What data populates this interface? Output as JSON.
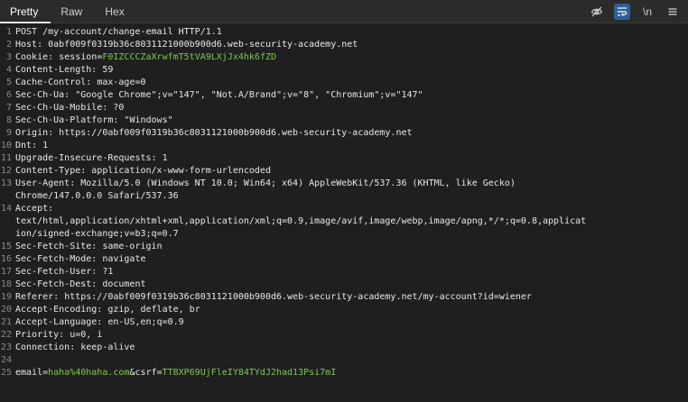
{
  "tabs": [
    {
      "label": "Pretty",
      "active": true
    },
    {
      "label": "Raw",
      "active": false
    },
    {
      "label": "Hex",
      "active": false
    }
  ],
  "toolbar": {
    "newline_label": "\\n",
    "icons": [
      "eye-slash-icon",
      "wrap-lines-icon",
      "newline-icon",
      "menu-icon"
    ]
  },
  "colors": {
    "background": "#1f1f1f",
    "param_value": "#7ec94f",
    "accent": "#2f5f96"
  },
  "lines": [
    {
      "n": "1",
      "parts": [
        {
          "t": "POST /my-account/change-email HTTP/1.1"
        }
      ]
    },
    {
      "n": "2",
      "parts": [
        {
          "t": "Host: "
        },
        {
          "t": "0abf009f0319b36c8031121000b900d6.web-security-academy.net"
        }
      ]
    },
    {
      "n": "3",
      "parts": [
        {
          "t": "Cookie: "
        },
        {
          "t": "session="
        },
        {
          "t": "F0IZCCCZaXrwfmT5tVA9LXjJx4hk6fZD",
          "c": "g"
        }
      ]
    },
    {
      "n": "4",
      "parts": [
        {
          "t": "Content-Length: "
        },
        {
          "t": "59"
        }
      ]
    },
    {
      "n": "5",
      "parts": [
        {
          "t": "Cache-Control: "
        },
        {
          "t": "max-age=0"
        }
      ]
    },
    {
      "n": "6",
      "parts": [
        {
          "t": "Sec-Ch-Ua: "
        },
        {
          "t": "\"Google Chrome\";v=\"147\", \"Not.A/Brand\";v=\"8\", \"Chromium\";v=\"147\""
        }
      ]
    },
    {
      "n": "7",
      "parts": [
        {
          "t": "Sec-Ch-Ua-Mobile: "
        },
        {
          "t": "?0"
        }
      ]
    },
    {
      "n": "8",
      "parts": [
        {
          "t": "Sec-Ch-Ua-Platform: "
        },
        {
          "t": "\"Windows\""
        }
      ]
    },
    {
      "n": "9",
      "parts": [
        {
          "t": "Origin: "
        },
        {
          "t": "https://0abf009f0319b36c8031121000b900d6.web-security-academy.net"
        }
      ]
    },
    {
      "n": "10",
      "parts": [
        {
          "t": "Dnt: "
        },
        {
          "t": "1"
        }
      ]
    },
    {
      "n": "11",
      "parts": [
        {
          "t": "Upgrade-Insecure-Requests: "
        },
        {
          "t": "1"
        }
      ]
    },
    {
      "n": "12",
      "parts": [
        {
          "t": "Content-Type: "
        },
        {
          "t": "application/x-www-form-urlencoded"
        }
      ]
    },
    {
      "n": "13",
      "parts": [
        {
          "t": "User-Agent: "
        },
        {
          "t": "Mozilla/5.0 (Windows NT 10.0; Win64; x64) AppleWebKit/537.36 (KHTML, like Gecko)"
        }
      ]
    },
    {
      "n": "",
      "parts": [
        {
          "t": "Chrome/147.0.0.0 Safari/537.36"
        }
      ]
    },
    {
      "n": "14",
      "parts": [
        {
          "t": "Accept: "
        }
      ]
    },
    {
      "n": "",
      "parts": [
        {
          "t": "text/html,application/xhtml+xml,application/xml;q=0.9,image/avif,image/webp,image/apng,*/*;q=0.8,applicat"
        }
      ]
    },
    {
      "n": "",
      "parts": [
        {
          "t": "ion/signed-exchange;v=b3;q=0.7"
        }
      ]
    },
    {
      "n": "15",
      "parts": [
        {
          "t": "Sec-Fetch-Site: "
        },
        {
          "t": "same-origin"
        }
      ]
    },
    {
      "n": "16",
      "parts": [
        {
          "t": "Sec-Fetch-Mode: "
        },
        {
          "t": "navigate"
        }
      ]
    },
    {
      "n": "17",
      "parts": [
        {
          "t": "Sec-Fetch-User: "
        },
        {
          "t": "?1"
        }
      ]
    },
    {
      "n": "18",
      "parts": [
        {
          "t": "Sec-Fetch-Dest: "
        },
        {
          "t": "document"
        }
      ]
    },
    {
      "n": "19",
      "parts": [
        {
          "t": "Referer: "
        },
        {
          "t": "https://0abf009f0319b36c8031121000b900d6.web-security-academy.net/my-account?id=wiener"
        }
      ]
    },
    {
      "n": "20",
      "parts": [
        {
          "t": "Accept-Encoding: "
        },
        {
          "t": "gzip, deflate, br"
        }
      ]
    },
    {
      "n": "21",
      "parts": [
        {
          "t": "Accept-Language: "
        },
        {
          "t": "en-US,en;q=0.9"
        }
      ]
    },
    {
      "n": "22",
      "parts": [
        {
          "t": "Priority: "
        },
        {
          "t": "u=0, i"
        }
      ]
    },
    {
      "n": "23",
      "parts": [
        {
          "t": "Connection: "
        },
        {
          "t": "keep-alive"
        }
      ]
    },
    {
      "n": "24",
      "parts": []
    },
    {
      "n": "25",
      "parts": [
        {
          "t": "email="
        },
        {
          "t": "haha%40haha.com",
          "c": "g"
        },
        {
          "t": "&csrf="
        },
        {
          "t": "TTBXP69UjFleIY84TYdJ2had13Psi7mI",
          "c": "g"
        }
      ]
    }
  ]
}
